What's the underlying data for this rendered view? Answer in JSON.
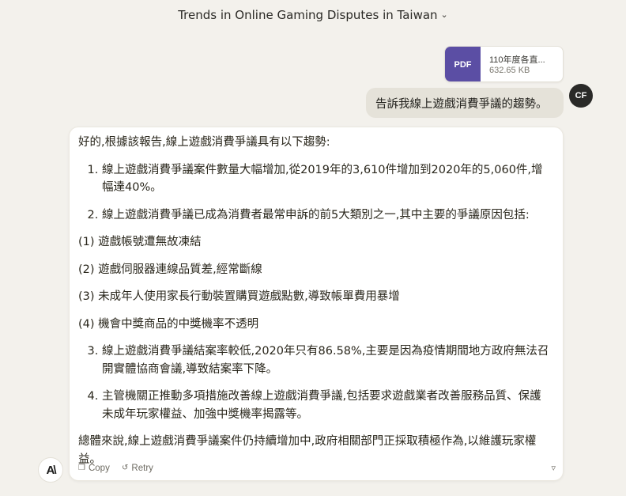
{
  "header": {
    "title": "Trends in Online Gaming Disputes in Taiwan"
  },
  "attachment": {
    "type_label": "PDF",
    "name": "110年度各直...",
    "size": "632.65 KB"
  },
  "user_message": {
    "text": "告訴我線上遊戲消費爭議的趨勢。",
    "avatar_initials": "CF"
  },
  "assistant": {
    "intro": "好的,根據該報告,線上遊戲消費爭議具有以下趨勢:",
    "items_a": [
      "線上遊戲消費爭議案件數量大幅增加,從2019年的3,610件增加到2020年的5,060件,增幅達40%。",
      "線上遊戲消費爭議已成為消費者最常申訴的前5大類別之一,其中主要的爭議原因包括:"
    ],
    "sub_items": [
      "(1) 遊戲帳號遭無故凍結",
      "(2) 遊戲伺服器連線品質差,經常斷線",
      "(3) 未成年人使用家長行動裝置購買遊戲點數,導致帳單費用暴增",
      "(4) 機會中獎商品的中獎機率不透明"
    ],
    "items_b": [
      "線上遊戲消費爭議結案率較低,2020年只有86.58%,主要是因為疫情期間地方政府無法召開實體協商會議,導致結案率下降。",
      "主管機關正推動多項措施改善線上遊戲消費爭議,包括要求遊戲業者改善服務品質、保護未成年玩家權益、加強中獎機率揭露等。"
    ],
    "conclusion": "總體來說,線上遊戲消費爭議案件仍持續增加中,政府相關部門正採取積極作為,以維護玩家權益。",
    "copy_label": "Copy",
    "retry_label": "Retry"
  },
  "logo": {
    "text": "A\\"
  }
}
